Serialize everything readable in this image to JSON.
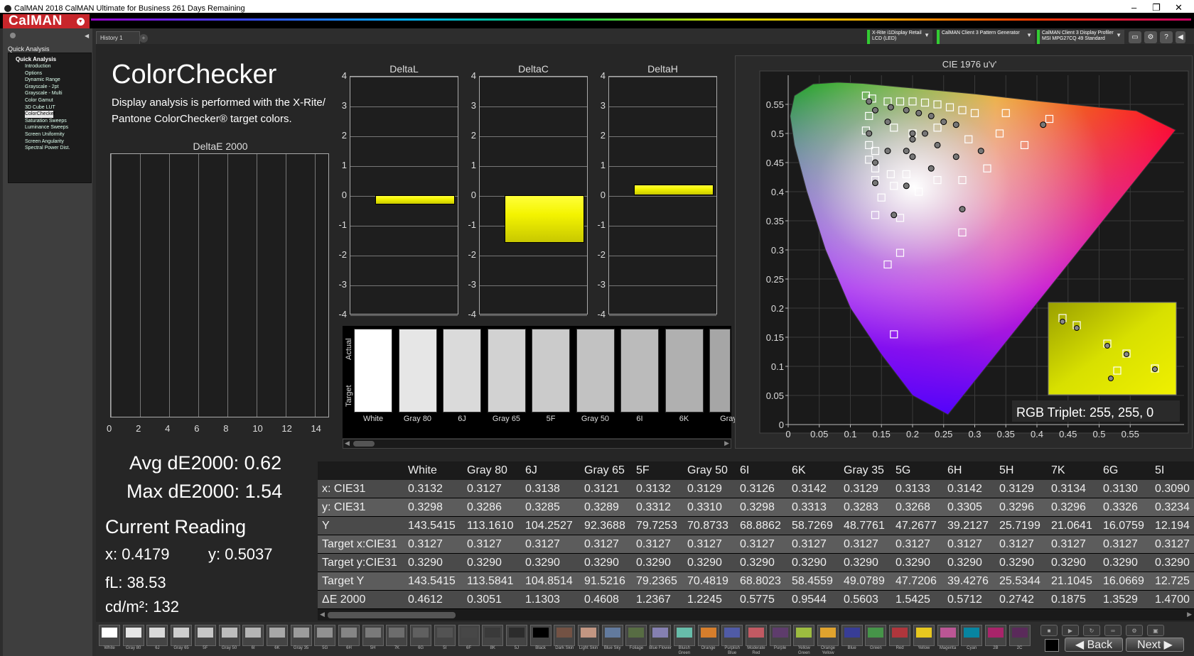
{
  "window": {
    "title": "CalMAN 2018 CalMAN Ultimate for Business 261 Days Remaining",
    "minimize": "–",
    "restore": "❐",
    "close": "✕"
  },
  "brand": {
    "logo": "CalMAN"
  },
  "sidebar": {
    "header": "Quick Analysis",
    "group": "Quick Analysis",
    "items": [
      {
        "label": "Introduction"
      },
      {
        "label": "Options"
      },
      {
        "label": "Dynamic Range"
      },
      {
        "label": "Grayscale - 2pt"
      },
      {
        "label": "Grayscale - Multi"
      },
      {
        "label": "Color Gamut"
      },
      {
        "label": "3D Cube LUT"
      },
      {
        "label": "ColorChecker",
        "selected": true
      },
      {
        "label": "Saturation Sweeps"
      },
      {
        "label": "Luminance Sweeps"
      },
      {
        "label": "Screen Uniformity"
      },
      {
        "label": "Screen Angularity"
      },
      {
        "label": "Spectral Power Dist."
      }
    ]
  },
  "tabs": {
    "history": "History 1"
  },
  "devices": [
    {
      "line1": "X-Rite i1Display Retail",
      "line2": "LCD (LED)"
    },
    {
      "line1": "CalMAN Client 3 Pattern Generator",
      "line2": ""
    },
    {
      "line1": "CalMAN Client 3 Display Profiler",
      "line2": "MSI MPG27CQ 49 Standard"
    }
  ],
  "page": {
    "title": "ColorChecker",
    "description": "Display analysis is performed with the X-Rite/ Pantone ColorChecker® target colors."
  },
  "deltae_chart": {
    "title": "DeltaE 2000",
    "xticks": [
      "0",
      "2",
      "4",
      "6",
      "8",
      "10",
      "12",
      "14"
    ],
    "xlim": [
      0,
      15
    ]
  },
  "delta_charts": [
    {
      "title": "DeltaL",
      "value": -0.3
    },
    {
      "title": "DeltaC",
      "value": -1.6
    },
    {
      "title": "DeltaH",
      "value": 0.35
    }
  ],
  "delta_yticks": [
    "4",
    "3",
    "2",
    "1",
    "0",
    "-1",
    "-2",
    "-3",
    "-4"
  ],
  "swatches": {
    "actual_label": "Actual",
    "target_label": "Target",
    "items": [
      {
        "name": "White",
        "color": "#ffffff"
      },
      {
        "name": "Gray 80",
        "color": "#e6e6e6"
      },
      {
        "name": "6J",
        "color": "#dadada"
      },
      {
        "name": "Gray 65",
        "color": "#d2d2d2"
      },
      {
        "name": "5F",
        "color": "#cbcbcb"
      },
      {
        "name": "Gray 50",
        "color": "#c2c2c2"
      },
      {
        "name": "6I",
        "color": "#bbbbbb"
      },
      {
        "name": "6K",
        "color": "#b0b0b0"
      },
      {
        "name": "Gray",
        "color": "#a6a6a6"
      }
    ]
  },
  "stats": {
    "avg": "Avg dE2000: 0.62",
    "max": "Max dE2000: 1.54",
    "current_reading": "Current Reading",
    "x": "x: 0.4179",
    "y": "y: 0.5037",
    "fl": "fL: 38.53",
    "cdm2": "cd/m²: 132"
  },
  "cie": {
    "title": "CIE 1976 u'v'",
    "xticks": [
      "0",
      "0.05",
      "0.1",
      "0.15",
      "0.2",
      "0.25",
      "0.3",
      "0.35",
      "0.4",
      "0.45",
      "0.5",
      "0.55"
    ],
    "yticks": [
      "0.55",
      "0.5",
      "0.45",
      "0.4",
      "0.35",
      "0.3",
      "0.25",
      "0.2",
      "0.15",
      "0.1",
      "0.05",
      "0"
    ],
    "rgb_triplet": "RGB Triplet: 255, 255, 0"
  },
  "chart_data": {
    "type": "scatter",
    "title": "CIE 1976 u'v'",
    "xlim": [
      0,
      0.6
    ],
    "ylim": [
      0,
      0.6
    ],
    "series": [
      {
        "name": "Target",
        "points": [
          [
            0.125,
            0.565
          ],
          [
            0.135,
            0.56
          ],
          [
            0.16,
            0.555
          ],
          [
            0.18,
            0.555
          ],
          [
            0.2,
            0.555
          ],
          [
            0.22,
            0.553
          ],
          [
            0.24,
            0.55
          ],
          [
            0.26,
            0.545
          ],
          [
            0.28,
            0.54
          ],
          [
            0.3,
            0.535
          ],
          [
            0.35,
            0.535
          ],
          [
            0.42,
            0.525
          ],
          [
            0.13,
            0.53
          ],
          [
            0.125,
            0.505
          ],
          [
            0.13,
            0.48
          ],
          [
            0.14,
            0.47
          ],
          [
            0.17,
            0.51
          ],
          [
            0.2,
            0.5
          ],
          [
            0.24,
            0.51
          ],
          [
            0.29,
            0.49
          ],
          [
            0.34,
            0.5
          ],
          [
            0.38,
            0.48
          ],
          [
            0.13,
            0.455
          ],
          [
            0.14,
            0.44
          ],
          [
            0.165,
            0.43
          ],
          [
            0.19,
            0.43
          ],
          [
            0.24,
            0.42
          ],
          [
            0.28,
            0.42
          ],
          [
            0.32,
            0.44
          ],
          [
            0.14,
            0.42
          ],
          [
            0.17,
            0.41
          ],
          [
            0.21,
            0.4
          ],
          [
            0.15,
            0.39
          ],
          [
            0.18,
            0.355
          ],
          [
            0.28,
            0.33
          ],
          [
            0.14,
            0.36
          ],
          [
            0.18,
            0.295
          ],
          [
            0.16,
            0.275
          ],
          [
            0.17,
            0.155
          ]
        ]
      },
      {
        "name": "Actual",
        "points": [
          [
            0.13,
            0.555
          ],
          [
            0.14,
            0.54
          ],
          [
            0.165,
            0.545
          ],
          [
            0.19,
            0.54
          ],
          [
            0.21,
            0.535
          ],
          [
            0.23,
            0.53
          ],
          [
            0.25,
            0.52
          ],
          [
            0.27,
            0.515
          ],
          [
            0.19,
            0.47
          ],
          [
            0.2,
            0.49
          ],
          [
            0.22,
            0.5
          ],
          [
            0.24,
            0.48
          ],
          [
            0.41,
            0.515
          ],
          [
            0.13,
            0.5
          ],
          [
            0.14,
            0.45
          ],
          [
            0.16,
            0.47
          ],
          [
            0.2,
            0.46
          ],
          [
            0.23,
            0.44
          ],
          [
            0.27,
            0.46
          ],
          [
            0.31,
            0.47
          ],
          [
            0.28,
            0.37
          ],
          [
            0.14,
            0.415
          ],
          [
            0.19,
            0.41
          ],
          [
            0.17,
            0.36
          ],
          [
            0.2,
            0.5
          ],
          [
            0.16,
            0.52
          ]
        ]
      }
    ]
  },
  "table": {
    "columns": [
      "White",
      "Gray 80",
      "6J",
      "Gray 65",
      "5F",
      "Gray 50",
      "6I",
      "6K",
      "Gray 35",
      "5G",
      "6H",
      "5H",
      "7K",
      "6G",
      "5I"
    ],
    "rows": [
      {
        "label": "x: CIE31",
        "values": [
          "0.3132",
          "0.3127",
          "0.3138",
          "0.3121",
          "0.3132",
          "0.3129",
          "0.3126",
          "0.3142",
          "0.3129",
          "0.3133",
          "0.3142",
          "0.3129",
          "0.3134",
          "0.3130",
          "0.3090"
        ]
      },
      {
        "label": "y: CIE31",
        "values": [
          "0.3298",
          "0.3286",
          "0.3285",
          "0.3289",
          "0.3312",
          "0.3310",
          "0.3298",
          "0.3313",
          "0.3283",
          "0.3268",
          "0.3305",
          "0.3296",
          "0.3296",
          "0.3326",
          "0.3234"
        ]
      },
      {
        "label": "Y",
        "values": [
          "143.5415",
          "113.1610",
          "104.2527",
          "92.3688",
          "79.7253",
          "70.8733",
          "68.8862",
          "58.7269",
          "48.7761",
          "47.2677",
          "39.2127",
          "25.7199",
          "21.0641",
          "16.0759",
          "12.194"
        ]
      },
      {
        "label": "Target x:CIE31",
        "values": [
          "0.3127",
          "0.3127",
          "0.3127",
          "0.3127",
          "0.3127",
          "0.3127",
          "0.3127",
          "0.3127",
          "0.3127",
          "0.3127",
          "0.3127",
          "0.3127",
          "0.3127",
          "0.3127",
          "0.3127"
        ]
      },
      {
        "label": "Target y:CIE31",
        "values": [
          "0.3290",
          "0.3290",
          "0.3290",
          "0.3290",
          "0.3290",
          "0.3290",
          "0.3290",
          "0.3290",
          "0.3290",
          "0.3290",
          "0.3290",
          "0.3290",
          "0.3290",
          "0.3290",
          "0.3290"
        ]
      },
      {
        "label": "Target Y",
        "values": [
          "143.5415",
          "113.5841",
          "104.8514",
          "91.5216",
          "79.2365",
          "70.4819",
          "68.8023",
          "58.4559",
          "49.0789",
          "47.7206",
          "39.4276",
          "25.5344",
          "21.1045",
          "16.0669",
          "12.725"
        ]
      },
      {
        "label": "ΔE 2000",
        "values": [
          "0.4612",
          "0.3051",
          "1.1303",
          "0.4608",
          "1.2367",
          "1.2245",
          "0.5775",
          "0.9544",
          "0.5603",
          "1.5425",
          "0.5712",
          "0.2742",
          "0.1875",
          "1.3529",
          "1.4700"
        ]
      }
    ]
  },
  "bottom_swatches": [
    {
      "label": "White",
      "color": "#ffffff"
    },
    {
      "label": "Gray 80",
      "color": "#e6e6e6"
    },
    {
      "label": "6J",
      "color": "#d9d9d9"
    },
    {
      "label": "Gray 65",
      "color": "#cfcfcf"
    },
    {
      "label": "5F",
      "color": "#c6c6c6"
    },
    {
      "label": "Gray 50",
      "color": "#bdbdbd"
    },
    {
      "label": "6I",
      "color": "#b5b5b5"
    },
    {
      "label": "6K",
      "color": "#a8a8a8"
    },
    {
      "label": "Gray 35",
      "color": "#9c9c9c"
    },
    {
      "label": "5G",
      "color": "#919191"
    },
    {
      "label": "6H",
      "color": "#858585"
    },
    {
      "label": "5H",
      "color": "#7a7a7a"
    },
    {
      "label": "7K",
      "color": "#6d6d6d"
    },
    {
      "label": "6G",
      "color": "#606060"
    },
    {
      "label": "5I",
      "color": "#535353"
    },
    {
      "label": "6F",
      "color": "#474747"
    },
    {
      "label": "8K",
      "color": "#3a3a3a"
    },
    {
      "label": "5J",
      "color": "#2c2c2c"
    },
    {
      "label": "Black",
      "color": "#000000"
    },
    {
      "label": "Dark Skin",
      "color": "#735244"
    },
    {
      "label": "Light Skin",
      "color": "#c29682"
    },
    {
      "label": "Blue Sky",
      "color": "#627a9d"
    },
    {
      "label": "Foliage",
      "color": "#576c43"
    },
    {
      "label": "Blue Flower",
      "color": "#8580b1"
    },
    {
      "label": "Bluish Green",
      "color": "#67bdaa"
    },
    {
      "label": "Orange",
      "color": "#d67e2c"
    },
    {
      "label": "Purplish Blue",
      "color": "#505ba6"
    },
    {
      "label": "Moderate Red",
      "color": "#c15a63"
    },
    {
      "label": "Purple",
      "color": "#5e3c6c"
    },
    {
      "label": "Yellow Green",
      "color": "#9dbc40"
    },
    {
      "label": "Orange Yellow",
      "color": "#e0a32e"
    },
    {
      "label": "Blue",
      "color": "#383d96"
    },
    {
      "label": "Green",
      "color": "#469449"
    },
    {
      "label": "Red",
      "color": "#af363c"
    },
    {
      "label": "Yellow",
      "color": "#e7c71f"
    },
    {
      "label": "Magenta",
      "color": "#bb5695"
    },
    {
      "label": "Cyan",
      "color": "#0885a1"
    },
    {
      "label": "2B",
      "color": "#a8246a"
    },
    {
      "label": "2C",
      "color": "#5a2a5a"
    }
  ],
  "nav": {
    "back": "Back",
    "next": "Next"
  }
}
